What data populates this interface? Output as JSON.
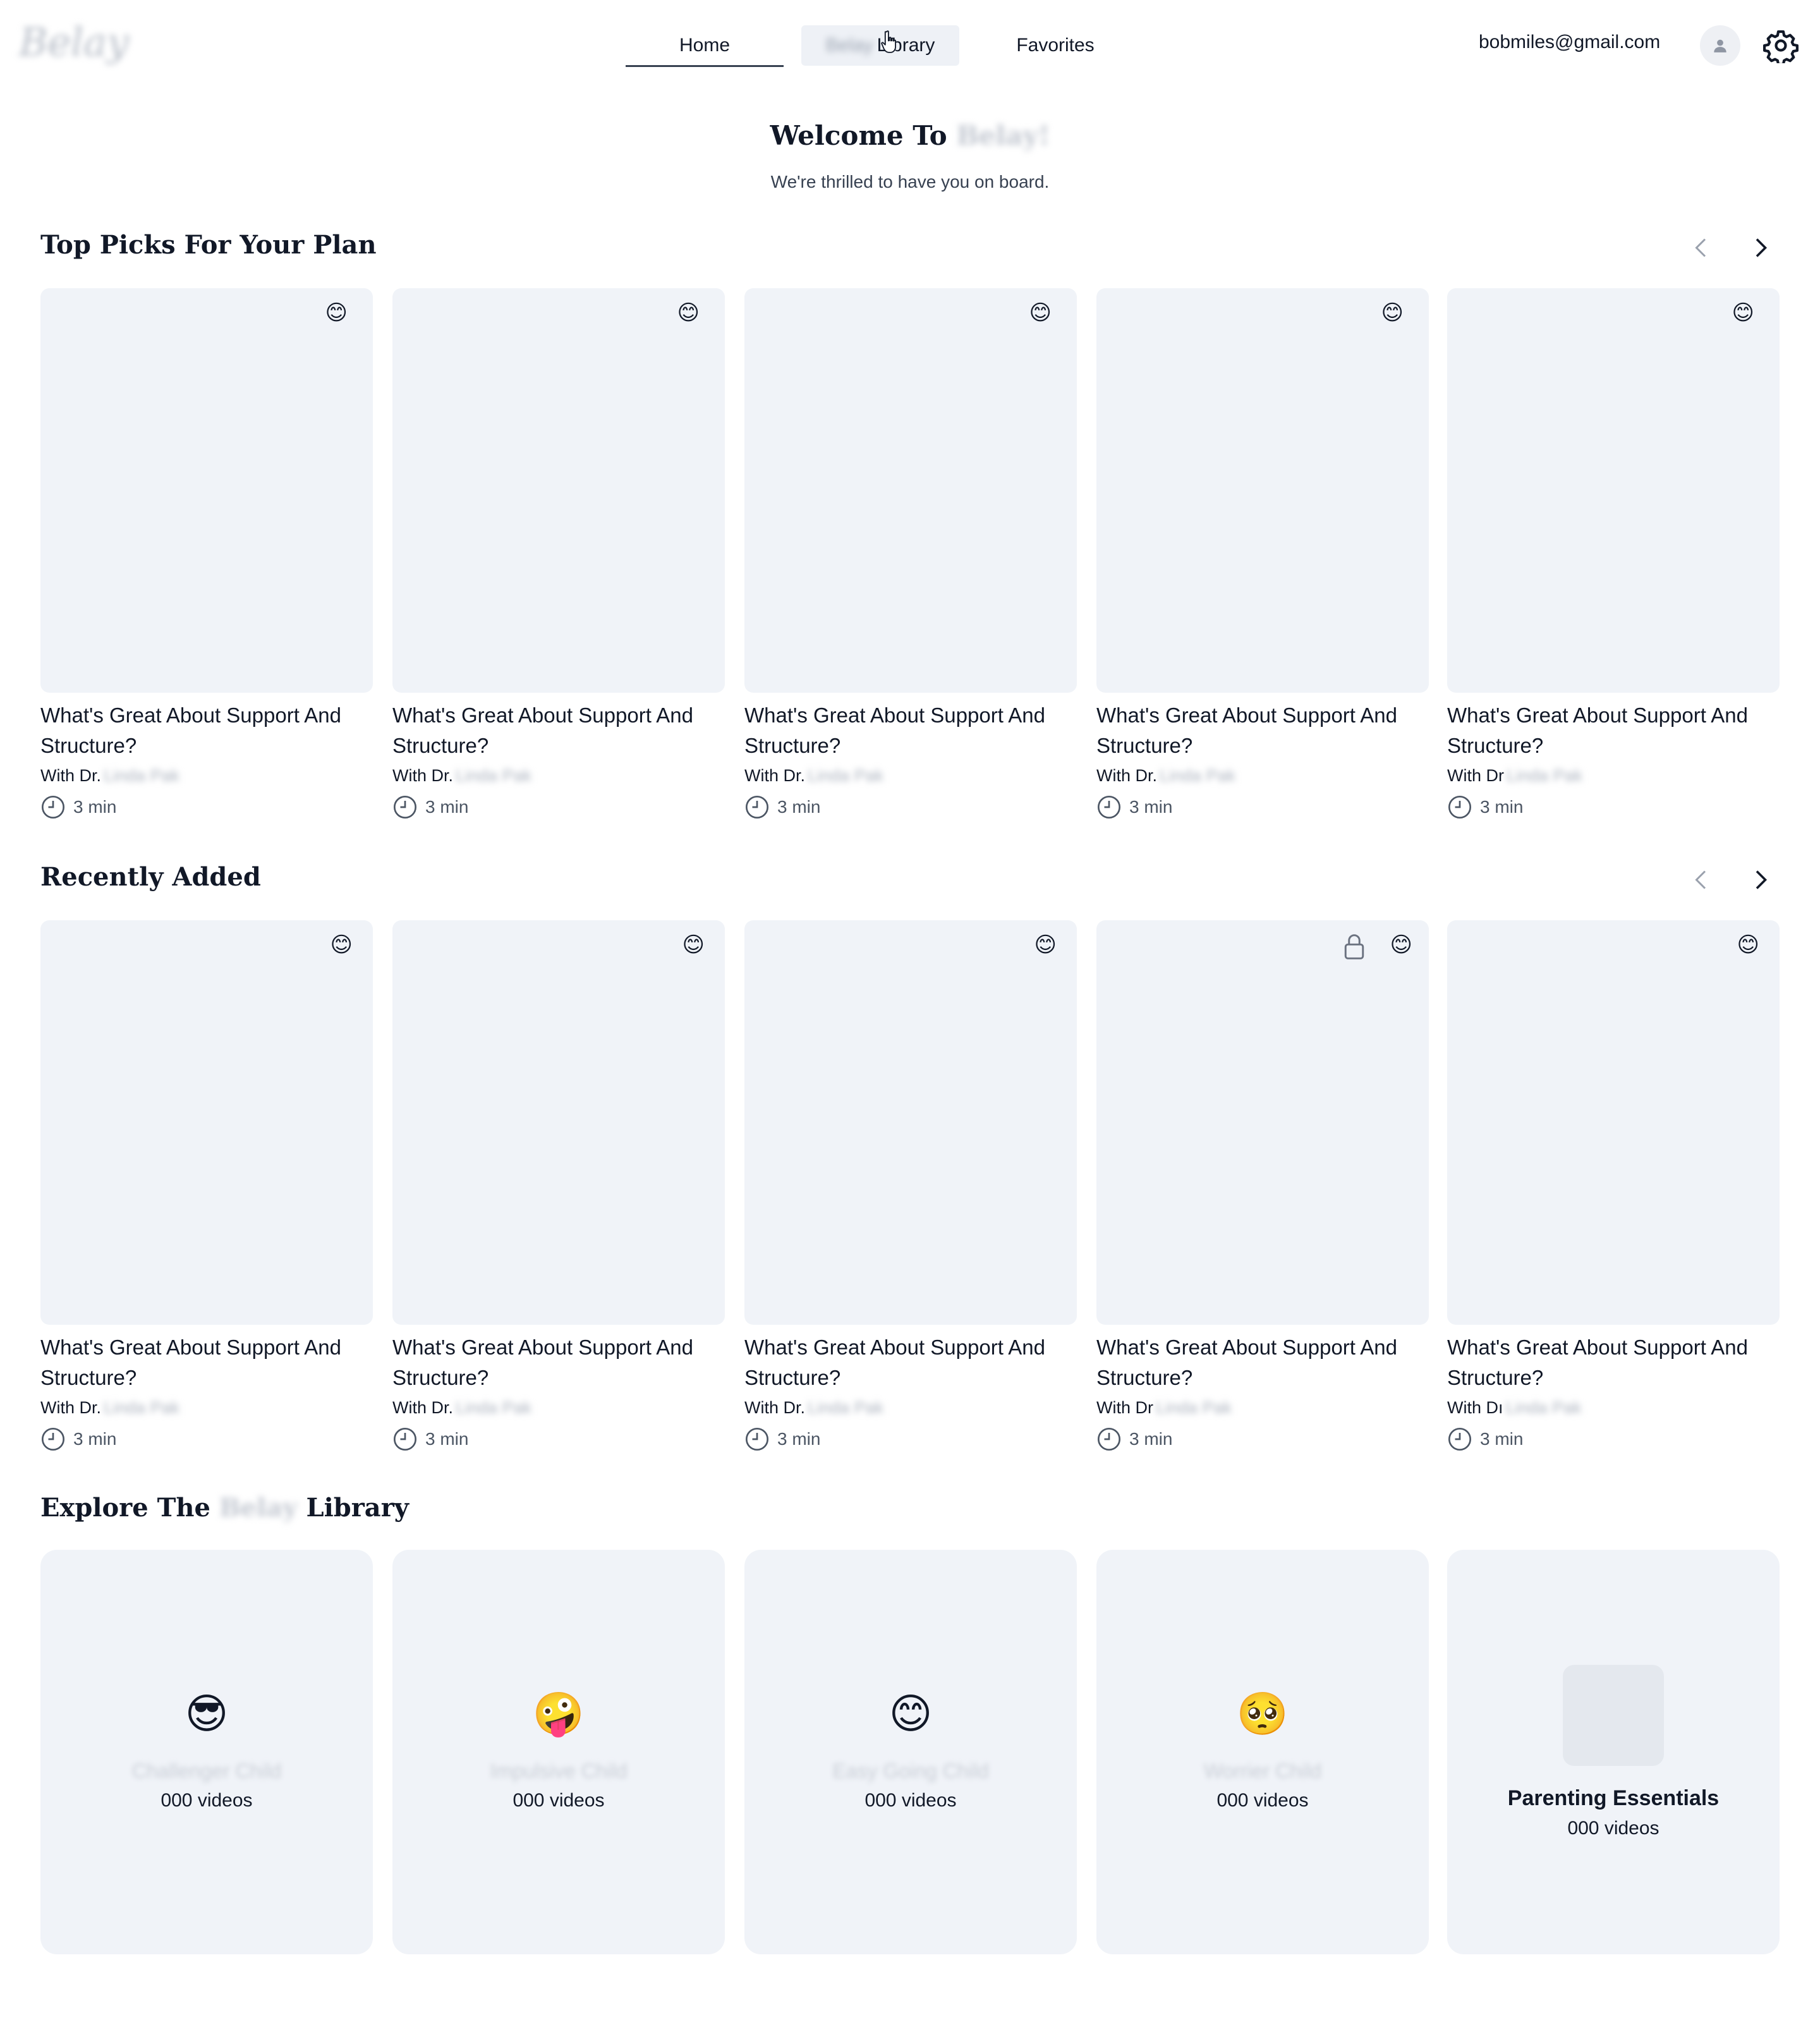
{
  "header": {
    "logo_text": "Belay",
    "nav": {
      "home": "Home",
      "library_brand": "Belay",
      "library_suffix": "Library",
      "favorites": "Favorites"
    },
    "user_email": "bobmiles@gmail.com"
  },
  "welcome": {
    "title_prefix": "Welcome To",
    "title_brand": "Belay!",
    "subtitle": "We're thrilled to have you on board."
  },
  "top_picks": {
    "title": "Top Picks For Your Plan",
    "cards": [
      {
        "title": "What's Great About Support And Structure?",
        "author_prefix": "With Dr.",
        "author_name": "Linda Pak",
        "duration": "3 min",
        "badge": "😊"
      },
      {
        "title": "What's Great About Support And Structure?",
        "author_prefix": "With Dr.",
        "author_name": "Linda Pak",
        "duration": "3 min",
        "badge": "😊"
      },
      {
        "title": "What's Great About Support And Structure?",
        "author_prefix": "With Dr.",
        "author_name": "Linda Pak",
        "duration": "3 min",
        "badge": "😊"
      },
      {
        "title": "What's Great About Support And Structure?",
        "author_prefix": "With Dr.",
        "author_name": "Linda Pak",
        "duration": "3 min",
        "badge": "😊"
      },
      {
        "title": "What's Great About Support And Structure?",
        "author_prefix": "With Dr",
        "author_name": "Linda Pak",
        "duration": "3 min",
        "badge": "😊"
      }
    ]
  },
  "recently_added": {
    "title": "Recently Added",
    "cards": [
      {
        "title": "What's Great About Support And Structure?",
        "author_prefix": "With Dr.",
        "author_name": "Linda Pak",
        "duration": "3 min",
        "badge": "😊"
      },
      {
        "title": "What's Great About Support And Structure?",
        "author_prefix": "With Dr.",
        "author_name": "Linda Pak",
        "duration": "3 min",
        "badge": "😊"
      },
      {
        "title": "What's Great About Support And Structure?",
        "author_prefix": "With Dr.",
        "author_name": "Linda Pak",
        "duration": "3 min",
        "badge": "😊"
      },
      {
        "title": "What's Great About Support And Structure?",
        "author_prefix": "With Dr",
        "author_name": "Linda Pak",
        "duration": "3 min",
        "badge": "😊",
        "locked": true
      },
      {
        "title": "What's Great About Support And Structure?",
        "author_prefix": "With Dı",
        "author_name": "Linda Pak",
        "duration": "3 min",
        "badge": "😊"
      }
    ]
  },
  "explore": {
    "title_prefix": "Explore The",
    "title_brand": "Belay",
    "title_suffix": "Library",
    "categories": [
      {
        "emoji": "😎",
        "name": "Challenger Child",
        "count": "000 videos"
      },
      {
        "emoji": "🤪",
        "name": "Impulsive Child",
        "count": "000 videos"
      },
      {
        "emoji": "😊",
        "name": "Easy Going Child",
        "count": "000 videos"
      },
      {
        "emoji": "🥺",
        "name": "Worrier Child",
        "count": "000 videos"
      },
      {
        "emoji": "",
        "name": "Parenting Essentials",
        "count": "000 videos"
      }
    ]
  },
  "icons": {
    "carousel_prev": "chevron-left-icon",
    "carousel_next": "chevron-right-icon",
    "duration": "clock-icon",
    "account": "user-icon",
    "settings": "gear-icon",
    "locked": "lock-icon"
  }
}
